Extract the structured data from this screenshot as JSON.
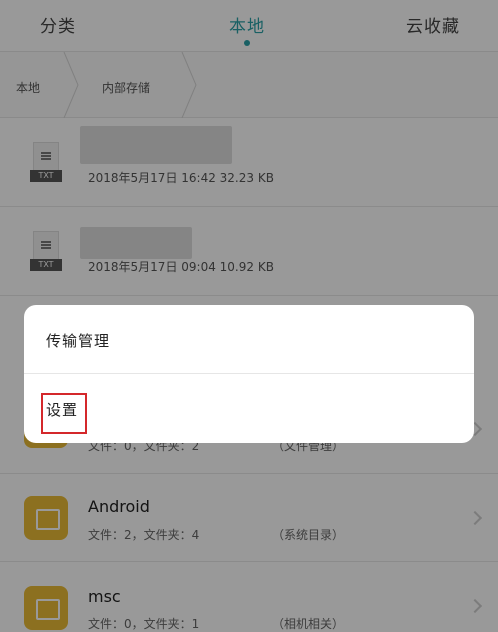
{
  "tabs": {
    "categories": "分类",
    "local": "本地",
    "cloud": "云收藏"
  },
  "breadcrumb": {
    "items": [
      "本地",
      "内部存储"
    ]
  },
  "files": [
    {
      "type_tag": "TXT",
      "meta": "2018年5月17日  16:42  32.23 KB",
      "icon": "txt-file-icon"
    },
    {
      "type_tag": "TXT",
      "meta": "2018年5月17日  09:04  10.92 KB",
      "icon": "txt-file-icon"
    }
  ],
  "folders": [
    {
      "name": "",
      "meta": "文件：0，文件夹：2",
      "category": "（文件管理）",
      "icon": "folder-icon"
    },
    {
      "name": "Android",
      "meta": "文件：2，文件夹：4",
      "category": "（系统目录）",
      "icon": "folder-icon"
    },
    {
      "name": "msc",
      "meta": "文件：0，文件夹：1",
      "category": "（相机相关）",
      "icon": "folder-icon"
    }
  ],
  "dialog": {
    "items": [
      "传输管理",
      "设置"
    ],
    "highlighted": "设置"
  },
  "colors": {
    "accent": "#2aa1a7",
    "folder": "#e9bb36",
    "highlight_box": "#d4282b"
  }
}
